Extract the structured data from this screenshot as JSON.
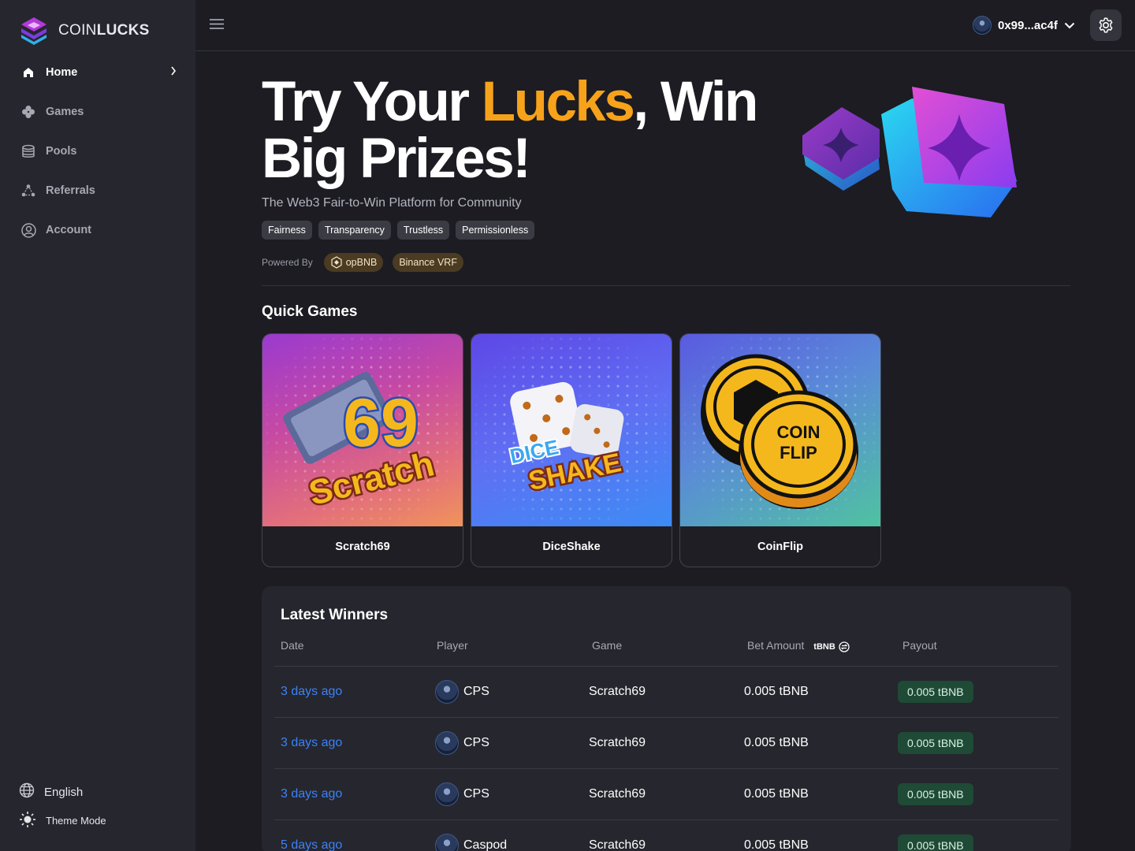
{
  "brand": {
    "name_light": "COIN",
    "name_bold": "LUCKS"
  },
  "sidebar": {
    "items": [
      {
        "label": "Home",
        "icon": "home-icon"
      },
      {
        "label": "Games",
        "icon": "clover-icon"
      },
      {
        "label": "Pools",
        "icon": "coins-stack-icon"
      },
      {
        "label": "Referrals",
        "icon": "network-icon"
      },
      {
        "label": "Account",
        "icon": "user-circle-icon"
      }
    ],
    "language": "English",
    "theme_label": "Theme Mode"
  },
  "topbar": {
    "wallet_address": "0x99...ac4f"
  },
  "hero": {
    "title_part1": "Try Your ",
    "title_accent": "Lucks",
    "title_part2": ", Win Big Prizes!",
    "subtitle": "The Web3 Fair-to-Win Platform for Community",
    "tags": [
      "Fairness",
      "Transparency",
      "Trustless",
      "Permissionless"
    ],
    "powered_by_label": "Powered By",
    "powered_by": [
      "opBNB",
      "Binance VRF"
    ]
  },
  "quick_games": {
    "title": "Quick Games",
    "games": [
      {
        "name": "Scratch69",
        "art_text_top": "69",
        "art_text_bottom": "Scratch"
      },
      {
        "name": "DiceShake",
        "art_text_top": "DICE",
        "art_text_bottom": "SHAKE"
      },
      {
        "name": "CoinFlip",
        "art_text_top": "COIN",
        "art_text_bottom": "FLIP"
      }
    ]
  },
  "winners": {
    "title": "Latest Winners",
    "columns": {
      "date": "Date",
      "player": "Player",
      "game": "Game",
      "bet": "Bet Amount",
      "bet_unit": "tBNB",
      "payout": "Payout"
    },
    "rows": [
      {
        "date": "3 days ago",
        "player": "CPS",
        "game": "Scratch69",
        "bet": "0.005 tBNB",
        "payout": "0.005 tBNB"
      },
      {
        "date": "3 days ago",
        "player": "CPS",
        "game": "Scratch69",
        "bet": "0.005 tBNB",
        "payout": "0.005 tBNB"
      },
      {
        "date": "3 days ago",
        "player": "CPS",
        "game": "Scratch69",
        "bet": "0.005 tBNB",
        "payout": "0.005 tBNB"
      },
      {
        "date": "5 days ago",
        "player": "Caspod",
        "game": "Scratch69",
        "bet": "0.005 tBNB",
        "payout": "0.005 tBNB"
      }
    ]
  },
  "colors": {
    "accent": "#f7a21b",
    "link": "#3b82f6",
    "payout_bg": "#1f4a36",
    "sidebar_bg": "#26262e",
    "page_bg": "#1c1c22"
  }
}
